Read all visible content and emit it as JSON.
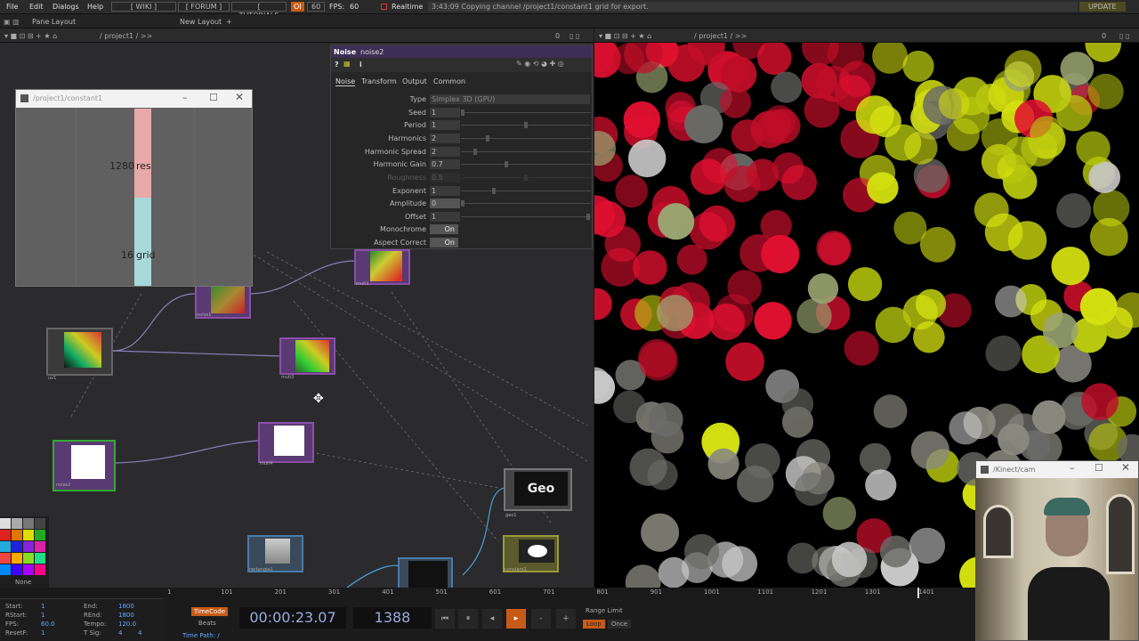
{
  "menu": {
    "file": "File",
    "edit": "Edit",
    "dialogs": "Dialogs",
    "help": "Help",
    "wiki": "[ WIKI ]",
    "forum": "[ FORUM ]",
    "tutorials": "[ TUTORIALS ]",
    "oi": "OI",
    "fps_target": "60",
    "fps_label": "FPS:",
    "fps_value": "60",
    "realtime": "Realtime",
    "status": "3:43:09 Copying channel /project1/constant1 grid for export.",
    "update": "UPDATE"
  },
  "panebar": {
    "pane_layout": "Pane Layout",
    "new_layout": "New Layout",
    "plus": "+"
  },
  "left_path": {
    "path": "/ project1 / >>",
    "zero": "0"
  },
  "right_path": {
    "path": "/ project1 / >>",
    "zero": "0"
  },
  "const_window": {
    "title": "/project1/constant1",
    "rows": [
      {
        "value": "1280",
        "name": "res",
        "fill": 0.95,
        "color": "#e8aaa8"
      },
      {
        "value": "16",
        "name": "grid",
        "fill": 0.95,
        "color": "#a8d8d8"
      }
    ]
  },
  "params": {
    "op_type": "Noise",
    "op_name": "noise2",
    "tabs": [
      "Noise",
      "Transform",
      "Output",
      "Common"
    ],
    "rows": [
      {
        "label": "Type",
        "value": "Simplex 3D (GPU)"
      },
      {
        "label": "Seed",
        "value": "1"
      },
      {
        "label": "Period",
        "value": "1"
      },
      {
        "label": "Harmonics",
        "value": "2"
      },
      {
        "label": "Harmonic Spread",
        "value": "2"
      },
      {
        "label": "Harmonic Gain",
        "value": "0.7"
      },
      {
        "label": "Roughness",
        "value": "0.5"
      },
      {
        "label": "Exponent",
        "value": "1"
      },
      {
        "label": "Amplitude",
        "value": "0"
      },
      {
        "label": "Offset",
        "value": "1"
      },
      {
        "label": "Monochrome",
        "value": "On"
      },
      {
        "label": "Aspect Correct",
        "value": "On"
      }
    ]
  },
  "nodes": {
    "mult1": "mult1",
    "noise1": "noise1",
    "uv1": "uv1",
    "mult3": "mult3",
    "noise2": "noise2",
    "mult4": "mult4",
    "geo1": "geo1",
    "geo_label": "Geo",
    "rectangle1": "rectangle1",
    "constant1": "constant1"
  },
  "palette": {
    "none": "None"
  },
  "timeline_ticks": [
    "1",
    "101",
    "201",
    "301",
    "401",
    "501",
    "601",
    "701",
    "801",
    "901",
    "1001",
    "1101",
    "1201",
    "1301",
    "1401"
  ],
  "time_settings": {
    "start_label": "Start:",
    "start": "1",
    "end_label": "End:",
    "end": "1800",
    "rstart_label": "RStart:",
    "rstart": "1",
    "rend_label": "REnd:",
    "rend": "1800",
    "fps_label": "FPS:",
    "fps": "60.0",
    "tempo_label": "Tempo:",
    "tempo": "120.0",
    "resetf_label": "ResetF:",
    "resetf": "1",
    "tsig_label": "T Sig:",
    "tsig_a": "4",
    "tsig_b": "4"
  },
  "transport": {
    "timecode": "TimeCode",
    "beats": "Beats",
    "time": "00:00:23.07",
    "frame": "1388",
    "range_limit": "Range Limit",
    "loop": "Loop",
    "once": "Once",
    "time_path": "Time Path: /",
    "minus": "-",
    "plus": "+"
  },
  "kinect": {
    "title": "/Kinect/cam"
  }
}
